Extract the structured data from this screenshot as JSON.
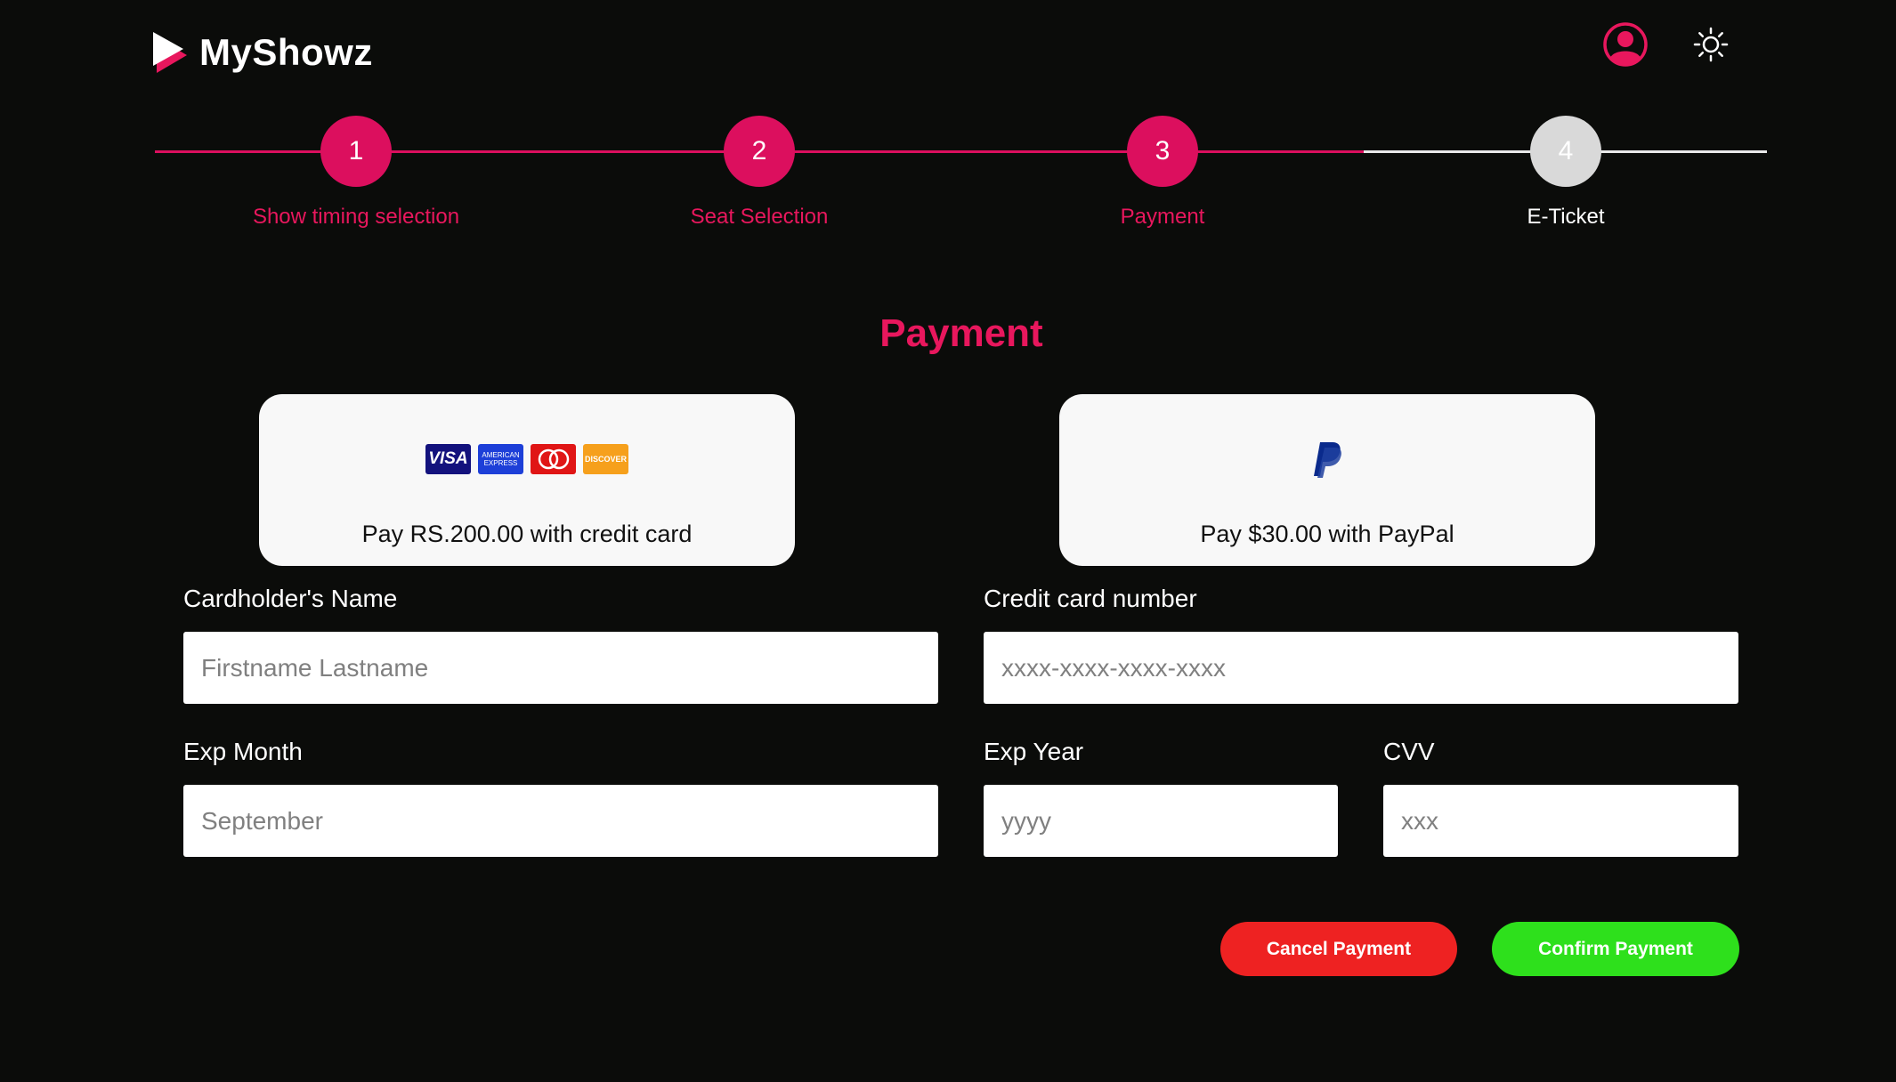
{
  "header": {
    "brand": "MyShowz",
    "icons": [
      "play-logo-icon",
      "user-avatar-icon",
      "sun-theme-icon"
    ]
  },
  "stepper": {
    "steps": [
      {
        "number": "1",
        "label": "Show timing selection",
        "status": "complete"
      },
      {
        "number": "2",
        "label": "Seat Selection",
        "status": "complete"
      },
      {
        "number": "3",
        "label": "Payment",
        "status": "active"
      },
      {
        "number": "4",
        "label": "E-Ticket",
        "status": "pending"
      }
    ]
  },
  "payment": {
    "title": "Payment",
    "methods": {
      "credit": {
        "label": "Pay RS.200.00 with credit card",
        "logos": {
          "visa": "VISA",
          "amex": "AMERICAN EXPRESS",
          "discover": "DISCOVER"
        }
      },
      "paypal": {
        "label": "Pay $30.00 with PayPal"
      }
    },
    "fields": {
      "name": {
        "label": "Cardholder's Name",
        "placeholder": "Firstname Lastname"
      },
      "card_number": {
        "label": "Credit card number",
        "placeholder": "xxxx-xxxx-xxxx-xxxx"
      },
      "exp_month": {
        "label": "Exp Month",
        "placeholder": "September"
      },
      "exp_year": {
        "label": "Exp Year",
        "placeholder": "yyyy"
      },
      "cvv": {
        "label": "CVV",
        "placeholder": "xxx"
      }
    },
    "buttons": {
      "cancel": "Cancel Payment",
      "confirm": "Confirm Payment"
    }
  },
  "colors": {
    "background": "#0b0c0a",
    "accent": "#e8175d",
    "pending": "#d9d9d9",
    "cancel": "#ee2222",
    "confirm": "#2ee01c"
  }
}
